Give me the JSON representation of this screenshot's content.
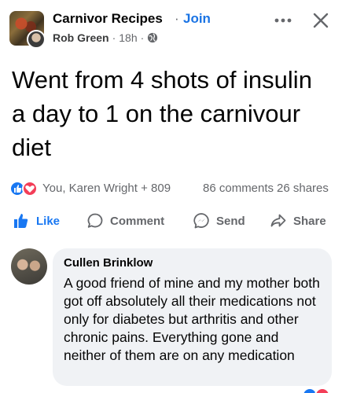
{
  "header": {
    "group_name": "Carnivor Recipes",
    "separator": "·",
    "join_label": "Join",
    "author": "Rob Green",
    "meta_separator": "·",
    "time": "18h",
    "privacy_icon": "globe-icon",
    "more_icon": "more-horizontal-icon",
    "close_icon": "close-icon"
  },
  "post": {
    "text": "Went from 4 shots of insulin a day to 1 on the carnivour diet"
  },
  "reactions": {
    "names": "You, Karen Wright + 809",
    "comments": "86 comments",
    "shares": "26 shares"
  },
  "actions": {
    "like": "Like",
    "comment": "Comment",
    "send": "Send",
    "share": "Share"
  },
  "comment": {
    "author": "Cullen Brinklow",
    "text": "A good friend of mine and my mother both got off absolutely all their medications not only for diabetes but arthritis and other chronic pains. Everything gone and neither of them are on any medication"
  },
  "colors": {
    "accent": "#1b74e4",
    "like_blue": "#1877f2",
    "love_red": "#f33e58",
    "muted_text": "#65676b",
    "bubble_bg": "#f0f2f5"
  }
}
